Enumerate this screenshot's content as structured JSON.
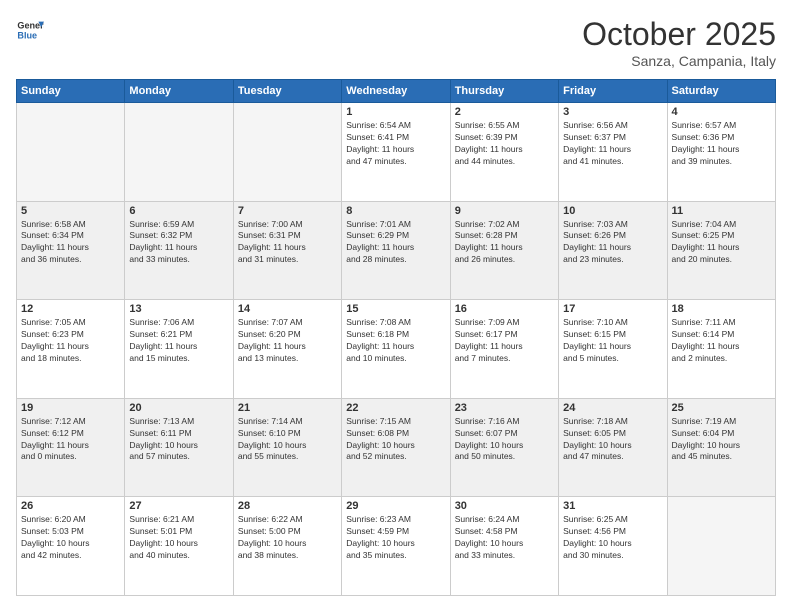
{
  "logo": {
    "text_general": "General",
    "text_blue": "Blue"
  },
  "header": {
    "month": "October 2025",
    "location": "Sanza, Campania, Italy"
  },
  "days_of_week": [
    "Sunday",
    "Monday",
    "Tuesday",
    "Wednesday",
    "Thursday",
    "Friday",
    "Saturday"
  ],
  "weeks": [
    {
      "days": [
        {
          "num": "",
          "info": ""
        },
        {
          "num": "",
          "info": ""
        },
        {
          "num": "",
          "info": ""
        },
        {
          "num": "1",
          "info": "Sunrise: 6:54 AM\nSunset: 6:41 PM\nDaylight: 11 hours\nand 47 minutes."
        },
        {
          "num": "2",
          "info": "Sunrise: 6:55 AM\nSunset: 6:39 PM\nDaylight: 11 hours\nand 44 minutes."
        },
        {
          "num": "3",
          "info": "Sunrise: 6:56 AM\nSunset: 6:37 PM\nDaylight: 11 hours\nand 41 minutes."
        },
        {
          "num": "4",
          "info": "Sunrise: 6:57 AM\nSunset: 6:36 PM\nDaylight: 11 hours\nand 39 minutes."
        }
      ],
      "shaded": false
    },
    {
      "days": [
        {
          "num": "5",
          "info": "Sunrise: 6:58 AM\nSunset: 6:34 PM\nDaylight: 11 hours\nand 36 minutes."
        },
        {
          "num": "6",
          "info": "Sunrise: 6:59 AM\nSunset: 6:32 PM\nDaylight: 11 hours\nand 33 minutes."
        },
        {
          "num": "7",
          "info": "Sunrise: 7:00 AM\nSunset: 6:31 PM\nDaylight: 11 hours\nand 31 minutes."
        },
        {
          "num": "8",
          "info": "Sunrise: 7:01 AM\nSunset: 6:29 PM\nDaylight: 11 hours\nand 28 minutes."
        },
        {
          "num": "9",
          "info": "Sunrise: 7:02 AM\nSunset: 6:28 PM\nDaylight: 11 hours\nand 26 minutes."
        },
        {
          "num": "10",
          "info": "Sunrise: 7:03 AM\nSunset: 6:26 PM\nDaylight: 11 hours\nand 23 minutes."
        },
        {
          "num": "11",
          "info": "Sunrise: 7:04 AM\nSunset: 6:25 PM\nDaylight: 11 hours\nand 20 minutes."
        }
      ],
      "shaded": true
    },
    {
      "days": [
        {
          "num": "12",
          "info": "Sunrise: 7:05 AM\nSunset: 6:23 PM\nDaylight: 11 hours\nand 18 minutes."
        },
        {
          "num": "13",
          "info": "Sunrise: 7:06 AM\nSunset: 6:21 PM\nDaylight: 11 hours\nand 15 minutes."
        },
        {
          "num": "14",
          "info": "Sunrise: 7:07 AM\nSunset: 6:20 PM\nDaylight: 11 hours\nand 13 minutes."
        },
        {
          "num": "15",
          "info": "Sunrise: 7:08 AM\nSunset: 6:18 PM\nDaylight: 11 hours\nand 10 minutes."
        },
        {
          "num": "16",
          "info": "Sunrise: 7:09 AM\nSunset: 6:17 PM\nDaylight: 11 hours\nand 7 minutes."
        },
        {
          "num": "17",
          "info": "Sunrise: 7:10 AM\nSunset: 6:15 PM\nDaylight: 11 hours\nand 5 minutes."
        },
        {
          "num": "18",
          "info": "Sunrise: 7:11 AM\nSunset: 6:14 PM\nDaylight: 11 hours\nand 2 minutes."
        }
      ],
      "shaded": false
    },
    {
      "days": [
        {
          "num": "19",
          "info": "Sunrise: 7:12 AM\nSunset: 6:12 PM\nDaylight: 11 hours\nand 0 minutes."
        },
        {
          "num": "20",
          "info": "Sunrise: 7:13 AM\nSunset: 6:11 PM\nDaylight: 10 hours\nand 57 minutes."
        },
        {
          "num": "21",
          "info": "Sunrise: 7:14 AM\nSunset: 6:10 PM\nDaylight: 10 hours\nand 55 minutes."
        },
        {
          "num": "22",
          "info": "Sunrise: 7:15 AM\nSunset: 6:08 PM\nDaylight: 10 hours\nand 52 minutes."
        },
        {
          "num": "23",
          "info": "Sunrise: 7:16 AM\nSunset: 6:07 PM\nDaylight: 10 hours\nand 50 minutes."
        },
        {
          "num": "24",
          "info": "Sunrise: 7:18 AM\nSunset: 6:05 PM\nDaylight: 10 hours\nand 47 minutes."
        },
        {
          "num": "25",
          "info": "Sunrise: 7:19 AM\nSunset: 6:04 PM\nDaylight: 10 hours\nand 45 minutes."
        }
      ],
      "shaded": true
    },
    {
      "days": [
        {
          "num": "26",
          "info": "Sunrise: 6:20 AM\nSunset: 5:03 PM\nDaylight: 10 hours\nand 42 minutes."
        },
        {
          "num": "27",
          "info": "Sunrise: 6:21 AM\nSunset: 5:01 PM\nDaylight: 10 hours\nand 40 minutes."
        },
        {
          "num": "28",
          "info": "Sunrise: 6:22 AM\nSunset: 5:00 PM\nDaylight: 10 hours\nand 38 minutes."
        },
        {
          "num": "29",
          "info": "Sunrise: 6:23 AM\nSunset: 4:59 PM\nDaylight: 10 hours\nand 35 minutes."
        },
        {
          "num": "30",
          "info": "Sunrise: 6:24 AM\nSunset: 4:58 PM\nDaylight: 10 hours\nand 33 minutes."
        },
        {
          "num": "31",
          "info": "Sunrise: 6:25 AM\nSunset: 4:56 PM\nDaylight: 10 hours\nand 30 minutes."
        },
        {
          "num": "",
          "info": ""
        }
      ],
      "shaded": false
    }
  ]
}
